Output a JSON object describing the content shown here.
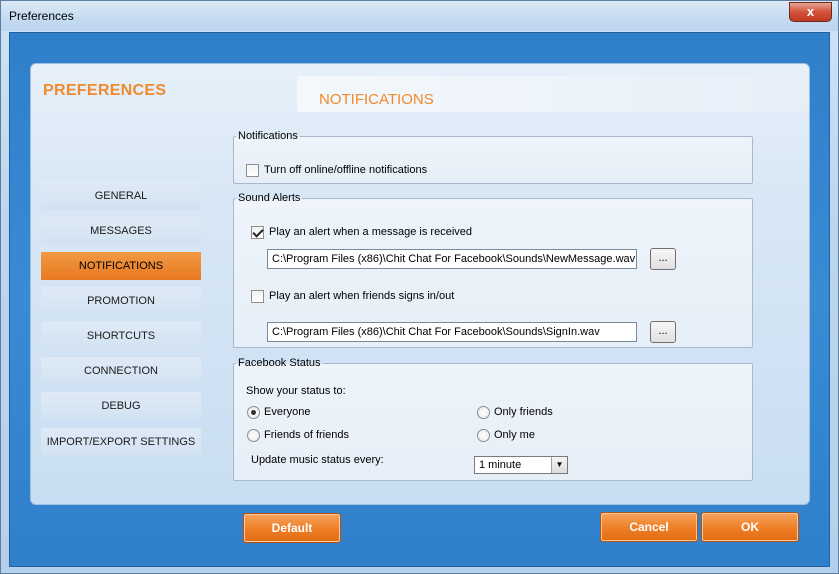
{
  "window": {
    "title": "Preferences",
    "close_symbol": "x"
  },
  "sidebar": {
    "heading": "PREFERENCES",
    "items": [
      {
        "label": "GENERAL"
      },
      {
        "label": "MESSAGES"
      },
      {
        "label": "NOTIFICATIONS",
        "active": true
      },
      {
        "label": "PROMOTION"
      },
      {
        "label": "SHORTCUTS"
      },
      {
        "label": "CONNECTION"
      },
      {
        "label": "DEBUG"
      },
      {
        "label": "IMPORT/EXPORT SETTINGS"
      }
    ]
  },
  "main": {
    "section_title": "NOTIFICATIONS",
    "notifications": {
      "legend": "Notifications",
      "turn_off_label": "Turn off online/offline notifications",
      "turn_off_checked": false
    },
    "sound_alerts": {
      "legend": "Sound Alerts",
      "message_alert_label": "Play an alert when a message is received",
      "message_alert_checked": true,
      "message_sound_path": "C:\\Program Files (x86)\\Chit Chat For Facebook\\Sounds\\NewMessage.wav",
      "signin_alert_label": "Play an alert when friends signs in/out",
      "signin_alert_checked": false,
      "signin_sound_path": "C:\\Program Files (x86)\\Chit Chat For Facebook\\Sounds\\SignIn.wav",
      "browse_label": "..."
    },
    "facebook_status": {
      "legend": "Facebook Status",
      "show_status_label": "Show your status to:",
      "options": [
        {
          "label": "Everyone",
          "checked": true
        },
        {
          "label": "Only friends",
          "checked": false
        },
        {
          "label": "Friends of friends",
          "checked": false
        },
        {
          "label": "Only me",
          "checked": false
        }
      ],
      "music_label": "Update music status every:",
      "music_value": "1 minute"
    }
  },
  "footer": {
    "default_label": "Default",
    "cancel_label": "Cancel",
    "ok_label": "OK"
  },
  "colors": {
    "accent_orange": "#f08a2c",
    "client_blue": "#2f7fcb"
  }
}
